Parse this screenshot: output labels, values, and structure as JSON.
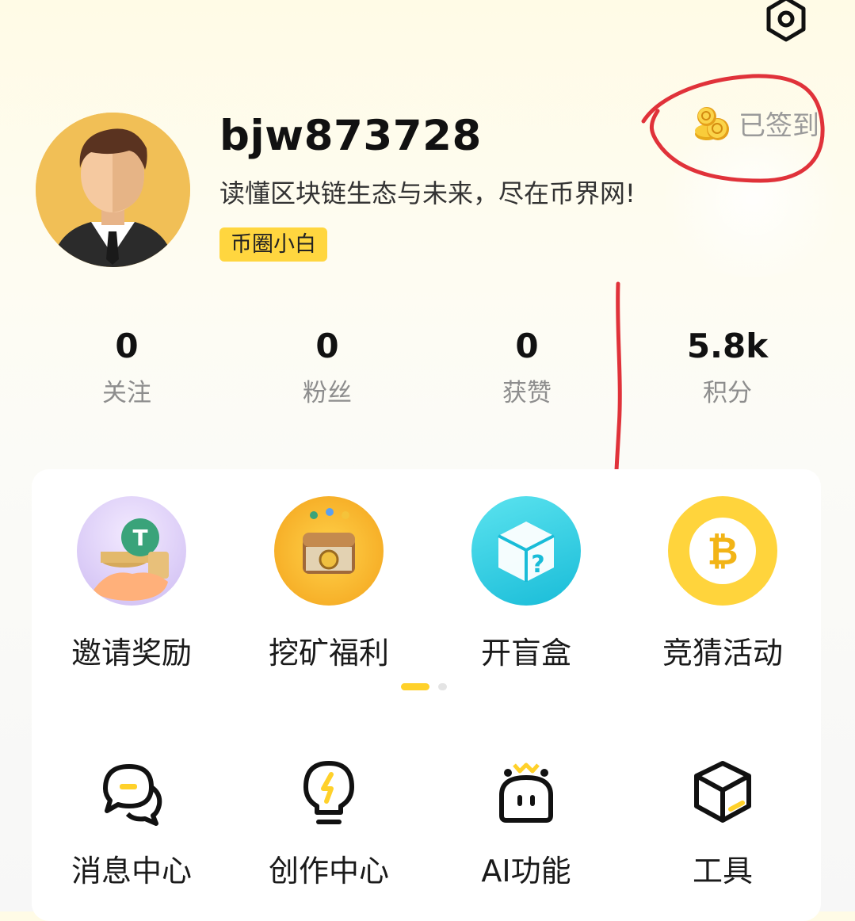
{
  "header": {
    "settings_icon": "settings-icon"
  },
  "profile": {
    "username": "bjw873728",
    "slogan": "读懂区块链生态与未来，尽在币界网!",
    "badge": "币圈小白",
    "checkin_label": "已签到"
  },
  "stats": [
    {
      "value": "0",
      "label": "关注"
    },
    {
      "value": "0",
      "label": "粉丝"
    },
    {
      "value": "0",
      "label": "获赞"
    },
    {
      "value": "5.8k",
      "label": "积分"
    }
  ],
  "features": [
    {
      "label": "邀请奖励",
      "icon": "invite-reward-icon"
    },
    {
      "label": "挖矿福利",
      "icon": "treasure-chest-icon"
    },
    {
      "label": "开盲盒",
      "icon": "mystery-box-icon"
    },
    {
      "label": "竞猜活动",
      "icon": "bitcoin-icon"
    }
  ],
  "pager": {
    "pages": 2,
    "current": 1
  },
  "tools": [
    {
      "label": "消息中心",
      "icon": "chat-bubbles-icon"
    },
    {
      "label": "创作中心",
      "icon": "lightbulb-icon"
    },
    {
      "label": "AI功能",
      "icon": "robot-icon"
    },
    {
      "label": "工具",
      "icon": "cube-icon"
    }
  ],
  "colors": {
    "accent": "#ffd12a",
    "annotation": "#e0323a",
    "muted_text": "#8d8d8d"
  }
}
